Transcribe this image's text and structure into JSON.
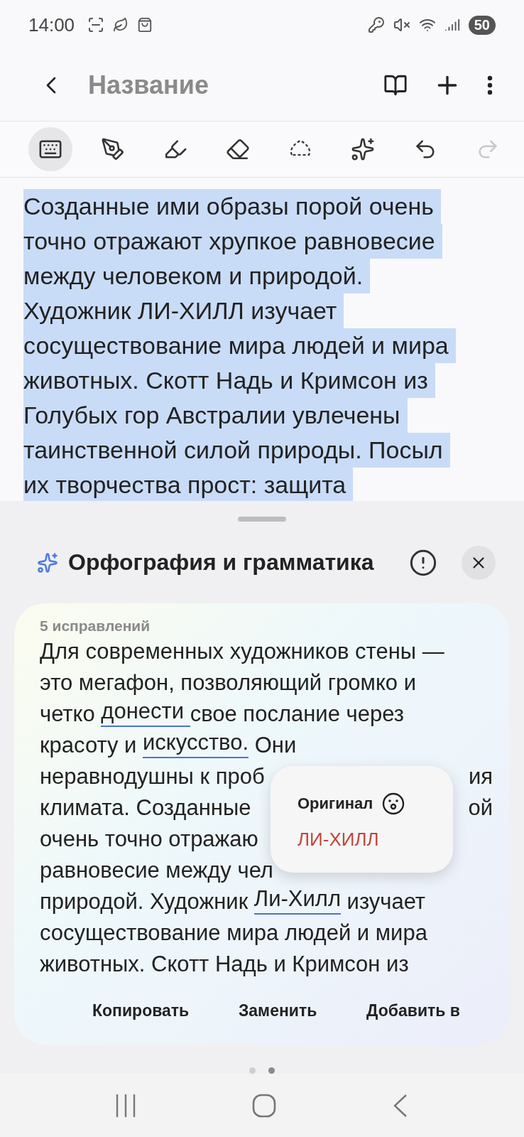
{
  "status_bar": {
    "time": "14:00",
    "battery": "50"
  },
  "app_bar": {
    "title": "Название"
  },
  "toolbar": [
    {
      "kind": "keyboard",
      "selected": true,
      "disabled": false
    },
    {
      "kind": "pen",
      "selected": false,
      "disabled": false
    },
    {
      "kind": "highlighter",
      "selected": false,
      "disabled": false
    },
    {
      "kind": "eraser",
      "selected": false,
      "disabled": false
    },
    {
      "kind": "lasso",
      "selected": false,
      "disabled": false
    },
    {
      "kind": "ai",
      "selected": false,
      "disabled": false
    },
    {
      "kind": "undo",
      "selected": false,
      "disabled": false
    },
    {
      "kind": "redo",
      "selected": false,
      "disabled": true
    }
  ],
  "note_lines": [
    {
      "text": "Созданные ими образы порой очень",
      "selected": true
    },
    {
      "text": "точно отражают хрупкое равновесие",
      "selected": true
    },
    {
      "text": "между человеком и природой.",
      "selected": true
    },
    {
      "text": "Художник ЛИ-ХИЛЛ изучает",
      "selected": true
    },
    {
      "text": "сосуществование мира людей и мира",
      "selected": true
    },
    {
      "text": "животных. Скотт Надь и Кримсон из",
      "selected": true
    },
    {
      "text": "Голубых гор Австралии увлечены",
      "selected": true
    },
    {
      "text": "таинственной силой природы. Посыл",
      "selected": true
    },
    {
      "text": "их творчества прост: защита",
      "selected": true
    }
  ],
  "sheet": {
    "title": "Орфография и грамматика",
    "card": {
      "count": "5 исправлений",
      "lines": [
        [
          {
            "text": "Для современных художников стены —",
            "underlined": false
          }
        ],
        [
          {
            "text": "это мегафон, позволяющий громко и",
            "underlined": false
          }
        ],
        [
          {
            "text": "четко ",
            "underlined": false
          },
          {
            "text": "донести ",
            "underlined": true
          },
          {
            "text": "свое послание через",
            "underlined": false
          }
        ],
        [
          {
            "text": "красоту и ",
            "underlined": false
          },
          {
            "text": "искусство.",
            "underlined": true
          },
          {
            "text": " Они",
            "underlined": false
          }
        ],
        [
          {
            "text": "неравнодушны к проб",
            "underlined": false
          },
          {
            "text": "ия",
            "underlined": false,
            "trailing": true
          }
        ],
        [
          {
            "text": "климата. Созданные",
            "underlined": false
          },
          {
            "text": "ой",
            "underlined": false,
            "trailing": true
          }
        ],
        [
          {
            "text": "очень точно отражаю",
            "underlined": false
          }
        ],
        [
          {
            "text": "равновесие между чел",
            "underlined": false
          }
        ],
        [
          {
            "text": "природой. Художник ",
            "underlined": false
          },
          {
            "text": "Ли-Хилл",
            "underlined": true
          },
          {
            "text": " изучает",
            "underlined": false
          }
        ],
        [
          {
            "text": "сосуществование мира людей и мира",
            "underlined": false
          }
        ],
        [
          {
            "text": "животных. Скотт Надь и Кримсон из",
            "underlined": false
          }
        ]
      ],
      "popup": {
        "title": "Оригинал",
        "original": "ЛИ-ХИЛЛ"
      },
      "actions": [
        "Копировать",
        "Заменить",
        "Добавить в"
      ]
    },
    "pages": [
      {
        "selected": false
      },
      {
        "selected": true
      }
    ]
  }
}
